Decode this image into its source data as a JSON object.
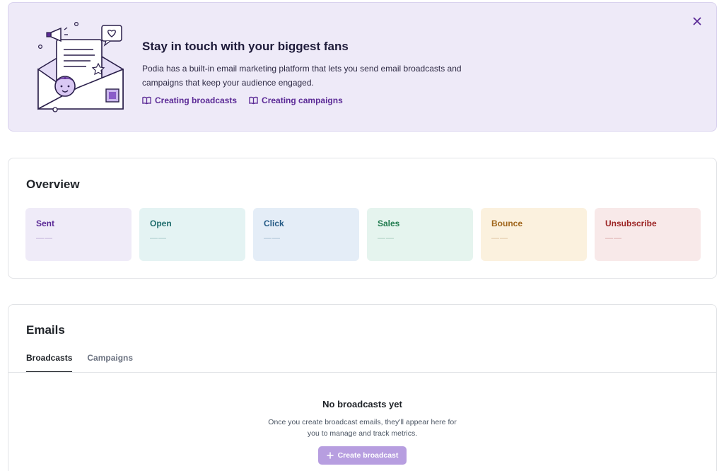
{
  "banner": {
    "title": "Stay in touch with your biggest fans",
    "description_line1": "Podia has a built-in email marketing platform that lets you send email broadcasts and",
    "description_line2": "campaigns that keep your audience engaged.",
    "links": [
      "Creating broadcasts",
      "Creating campaigns"
    ],
    "close_icon": "close-icon",
    "link_icon": "book-icon",
    "accent_color": "#5b2a96"
  },
  "overview": {
    "title": "Overview",
    "metrics": [
      {
        "label": "Sent",
        "value": "——",
        "bg": "#efebf8",
        "color": "#5b2a96"
      },
      {
        "label": "Open",
        "value": "——",
        "bg": "#e4f3f3",
        "color": "#1d6b6b"
      },
      {
        "label": "Click",
        "value": "——",
        "bg": "#e4edf7",
        "color": "#245a85"
      },
      {
        "label": "Sales",
        "value": "——",
        "bg": "#e5f4ee",
        "color": "#1f7a4d"
      },
      {
        "label": "Bounce",
        "value": "——",
        "bg": "#fbf1de",
        "color": "#a0661b"
      },
      {
        "label": "Unsubscribe",
        "value": "——",
        "bg": "#f8e9e9",
        "color": "#9c2424"
      }
    ]
  },
  "emails": {
    "title": "Emails",
    "tabs": [
      "Broadcasts",
      "Campaigns"
    ],
    "active_tab": "Broadcasts",
    "empty_title": "No broadcasts yet",
    "empty_line1": "Once you create broadcast emails, they'll appear here for",
    "empty_line2": "you to manage and track metrics.",
    "create_button": "Create broadcast",
    "create_icon": "plus-icon"
  }
}
